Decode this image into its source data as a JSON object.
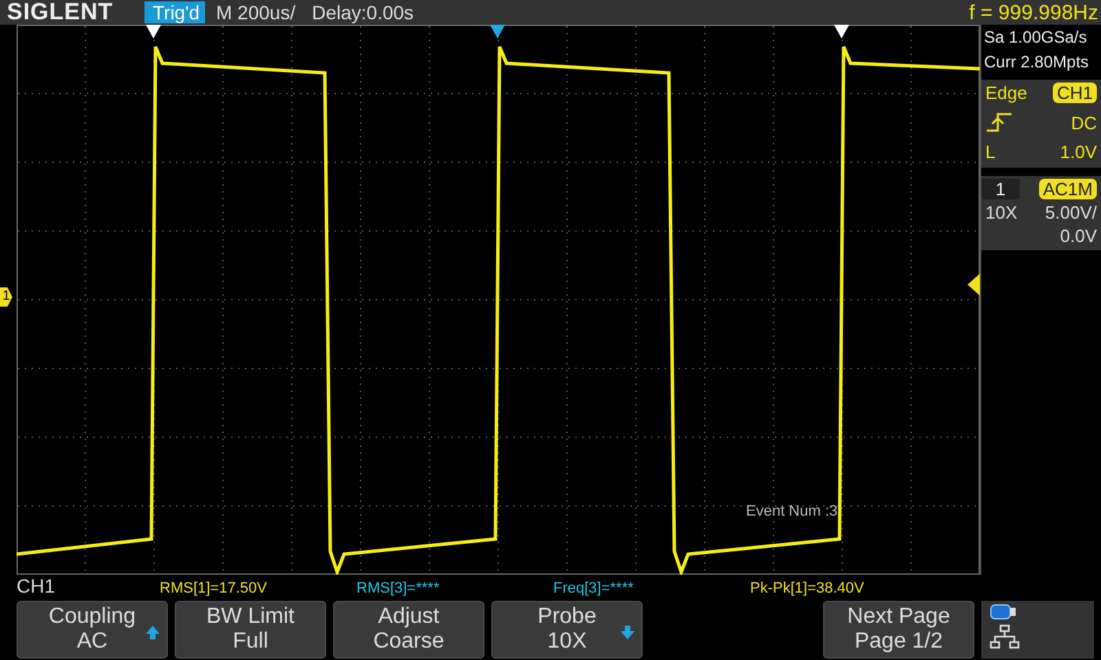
{
  "header": {
    "brand": "SIGLENT",
    "trigger_status": "Trig'd",
    "timebase": "M 200us/",
    "delay": "Delay:0.00s",
    "frequency": "f = 999.998Hz"
  },
  "trigger_markers": [
    {
      "color": "#ffffff"
    },
    {
      "color": "#1fa8e0"
    },
    {
      "color": "#ffffff"
    }
  ],
  "channel_marker": "1",
  "event_text": "Event Num :3",
  "side_panel": {
    "sample_rate": "Sa 1.00GSa/s",
    "memory_depth": "Curr 2.80Mpts",
    "trigger": {
      "type": "Edge",
      "source": "CH1",
      "coupling": "DC",
      "level_label": "L",
      "level": "1.0V"
    },
    "channel": {
      "number": "1",
      "coupling": "AC1M",
      "probe": "10X",
      "scale": "5.00V/",
      "offset": "0.0V"
    }
  },
  "measurements": {
    "channel": "CH1",
    "items": [
      {
        "text": "RMS[1]=17.50V",
        "color": "#f0e020"
      },
      {
        "text": "RMS[3]=****",
        "color": "#1fc8e8"
      },
      {
        "text": "Freq[3]=****",
        "color": "#1fc8e8"
      },
      {
        "text": "Pk-Pk[1]=38.40V",
        "color": "#f0e020"
      }
    ]
  },
  "soft_keys": [
    {
      "title": "Coupling",
      "value": "AC",
      "arrow_up": true,
      "arrow_down": false
    },
    {
      "title": "BW Limit",
      "value": "Full",
      "arrow_up": false,
      "arrow_down": false
    },
    {
      "title": "Adjust",
      "value": "Coarse",
      "arrow_up": false,
      "arrow_down": false
    },
    {
      "title": "Probe",
      "value": "10X",
      "arrow_up": false,
      "arrow_down": true
    }
  ],
  "next_page": {
    "title": "Next Page",
    "value": "Page 1/2"
  }
}
